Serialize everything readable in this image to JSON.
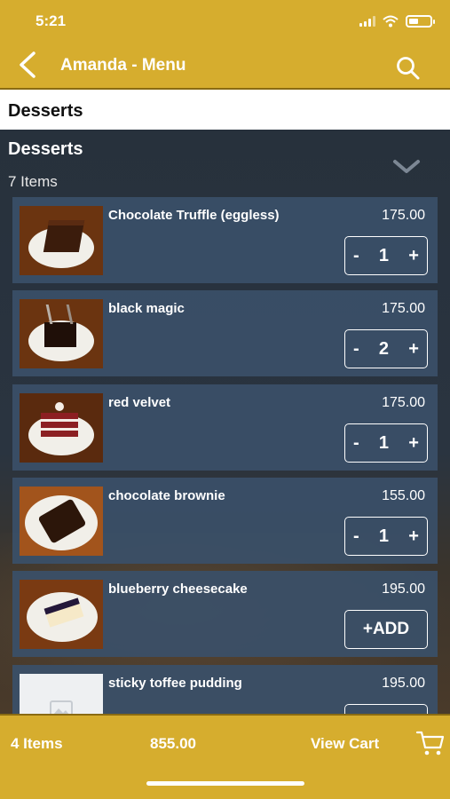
{
  "status_bar": {
    "time": "5:21"
  },
  "header": {
    "title": "Amanda - Menu"
  },
  "section_bar": {
    "label": "Desserts"
  },
  "category": {
    "title": "Desserts",
    "count": "7 Items"
  },
  "items": [
    {
      "name": "Chocolate Truffle (eggless)",
      "price": "175.00",
      "qty": "1",
      "minus": "-",
      "plus": "+"
    },
    {
      "name": "black magic",
      "price": "175.00",
      "qty": "2",
      "minus": "-",
      "plus": "+"
    },
    {
      "name": "red velvet",
      "price": "175.00",
      "qty": "1",
      "minus": "-",
      "plus": "+"
    },
    {
      "name": "chocolate brownie",
      "price": "155.00",
      "qty": "1",
      "minus": "-",
      "plus": "+"
    },
    {
      "name": "blueberry cheesecake",
      "price": "195.00",
      "add_label": "+ADD"
    },
    {
      "name": "sticky toffee pudding",
      "price": "195.00"
    }
  ],
  "cart": {
    "items": "4 Items",
    "total": "855.00",
    "view_label": "View Cart"
  },
  "colors": {
    "accent": "#d6ad2e",
    "card": "#3a5068",
    "background": "#1e2630"
  },
  "icons": [
    "back-icon",
    "search-icon",
    "chevron-down-icon",
    "cart-icon"
  ]
}
